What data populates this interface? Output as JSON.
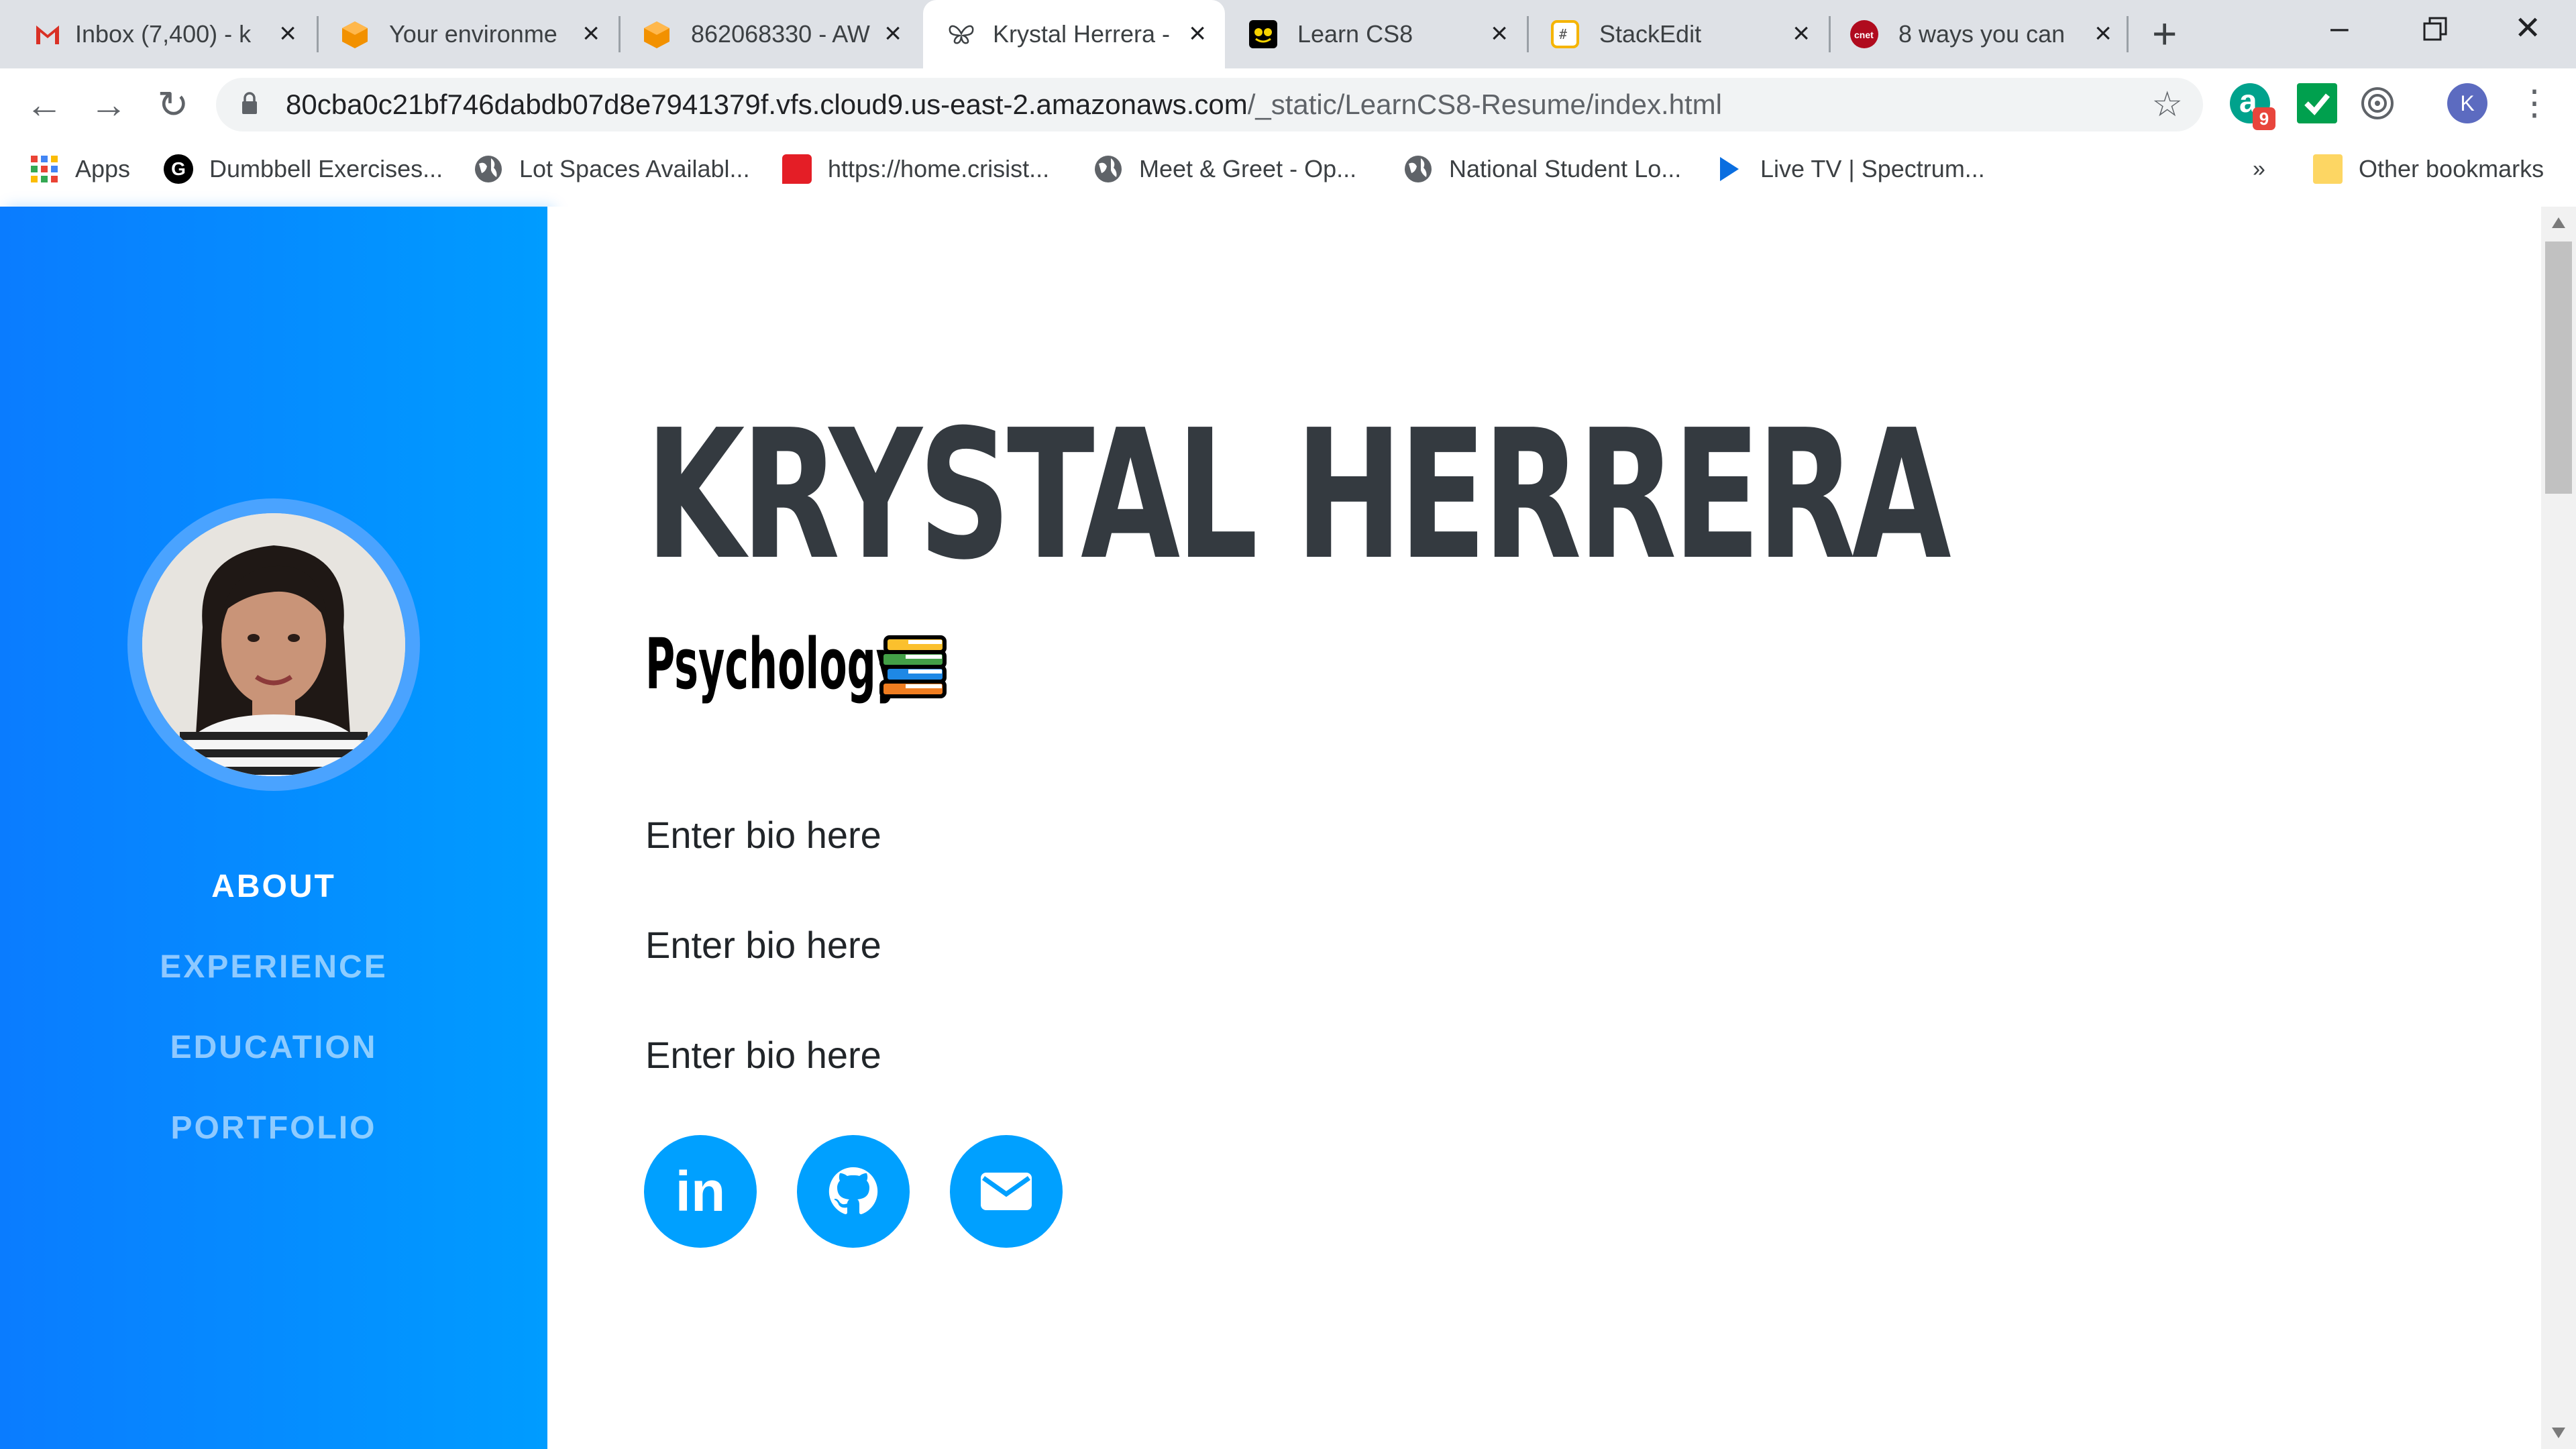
{
  "browser": {
    "tabs": [
      {
        "title": "Inbox (7,400) - k",
        "icon": "gmail-icon"
      },
      {
        "title": "Your environme",
        "icon": "aws-icon"
      },
      {
        "title": "862068330 - AW",
        "icon": "aws-icon"
      },
      {
        "title": "Krystal Herrera -",
        "icon": "butterfly-icon",
        "active": true
      },
      {
        "title": "Learn CS8",
        "icon": "cs8-icon"
      },
      {
        "title": "StackEdit",
        "icon": "stackedit-icon"
      },
      {
        "title": "8 ways you can",
        "icon": "cnet-icon"
      }
    ],
    "url_host": "80cba0c21bf746dabdb07d8e7941379f.vfs.cloud9.us-east-2.amazonaws.com",
    "url_path": "/_static/LearnCS8-Resume/index.html",
    "ext_badge": "9",
    "profile_initial": "K",
    "bookmarks": [
      {
        "label": "Apps",
        "icon": "apps-grid-icon"
      },
      {
        "label": "Dumbbell Exercises...",
        "icon": "g-icon"
      },
      {
        "label": "Lot Spaces Availabl...",
        "icon": "globe-icon"
      },
      {
        "label": "https://home.crisist...",
        "icon": "red-flag-icon"
      },
      {
        "label": "Meet & Greet - Op...",
        "icon": "globe-icon"
      },
      {
        "label": "National Student Lo...",
        "icon": "globe-icon"
      },
      {
        "label": "Live TV | Spectrum...",
        "icon": "play-icon"
      }
    ],
    "bookmarks_more": "»",
    "other_bookmarks": "Other bookmarks"
  },
  "sidebar": {
    "nav": [
      {
        "label": "ABOUT",
        "active": true
      },
      {
        "label": "EXPERIENCE"
      },
      {
        "label": "EDUCATION"
      },
      {
        "label": "PORTFOLIO"
      }
    ]
  },
  "main": {
    "name": "KRYSTAL HERRERA",
    "subtitle": "Psychology",
    "bio": [
      "Enter bio here",
      "Enter bio here",
      "Enter bio here"
    ],
    "social": [
      {
        "label": "in",
        "icon": "linkedin-icon"
      },
      {
        "icon": "github-icon"
      },
      {
        "icon": "envelope-icon"
      }
    ]
  },
  "colors": {
    "sidebar_start": "#0a7cff",
    "sidebar_end": "#009cff",
    "accent": "#00a0ff",
    "heading": "#343a40"
  }
}
